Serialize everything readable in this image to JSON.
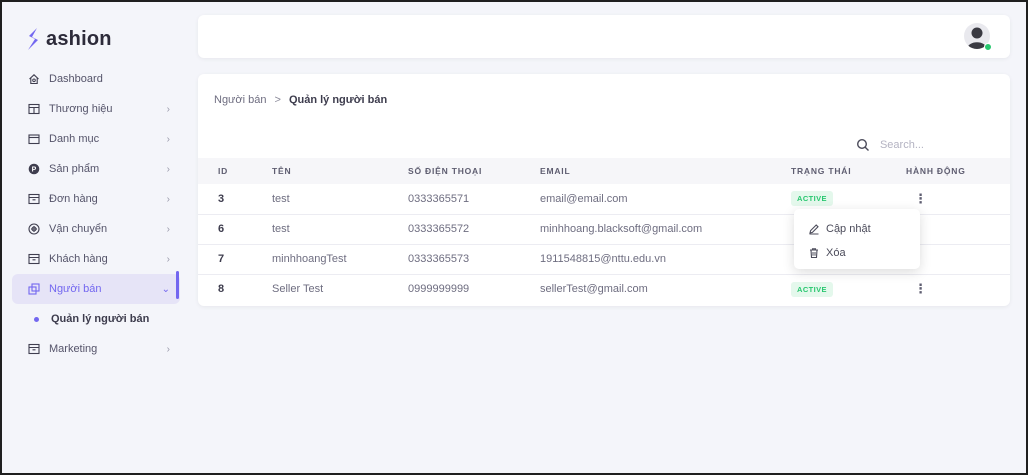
{
  "brand": {
    "name": "ashion",
    "accent": "#7367f0"
  },
  "sidebar": {
    "items": [
      {
        "label": "Dashboard",
        "icon": "home-icon",
        "chevron": false
      },
      {
        "label": "Thương hiệu",
        "icon": "table-icon",
        "chevron": true
      },
      {
        "label": "Danh mục",
        "icon": "folder-icon",
        "chevron": true
      },
      {
        "label": "Sản phẩm",
        "icon": "product-icon",
        "chevron": true
      },
      {
        "label": "Đơn hàng",
        "icon": "box-icon",
        "chevron": true
      },
      {
        "label": "Vận chuyển",
        "icon": "shipping-icon",
        "chevron": true
      },
      {
        "label": "Khách hàng",
        "icon": "box-icon",
        "chevron": true
      },
      {
        "label": "Người bán",
        "icon": "seller-icon",
        "chevron": true,
        "active": true
      },
      {
        "label": "Marketing",
        "icon": "box-icon",
        "chevron": true
      }
    ],
    "sub_item": "Quản lý người bán"
  },
  "breadcrumb": {
    "parent": "Người bán",
    "separator": ">",
    "current": "Quản lý người bán"
  },
  "search": {
    "placeholder": "Search..."
  },
  "table": {
    "headers": {
      "id": "ID",
      "name": "TÊN",
      "phone": "SỐ ĐIỆN THOẠI",
      "email": "EMAIL",
      "status": "TRẠNG THÁI",
      "action": "HÀNH ĐỘNG"
    },
    "rows": [
      {
        "id": "3",
        "name": "test",
        "phone": "0333365571",
        "email": "email@email.com",
        "status": "ACTIVE"
      },
      {
        "id": "6",
        "name": "test",
        "phone": "0333365572",
        "email": "minhhoang.blacksoft@gmail.com",
        "status": ""
      },
      {
        "id": "7",
        "name": "minhhoangTest",
        "phone": "0333365573",
        "email": "1911548815@nttu.edu.vn",
        "status": ""
      },
      {
        "id": "8",
        "name": "Seller Test",
        "phone": "0999999999",
        "email": "sellerTest@gmail.com",
        "status": "ACTIVE"
      }
    ]
  },
  "dropdown": {
    "update_label": "Cập nhật",
    "delete_label": "Xóa"
  },
  "colors": {
    "status_active_bg": "#e4f8ec",
    "status_active_text": "#28c76f",
    "online": "#28c76f"
  }
}
